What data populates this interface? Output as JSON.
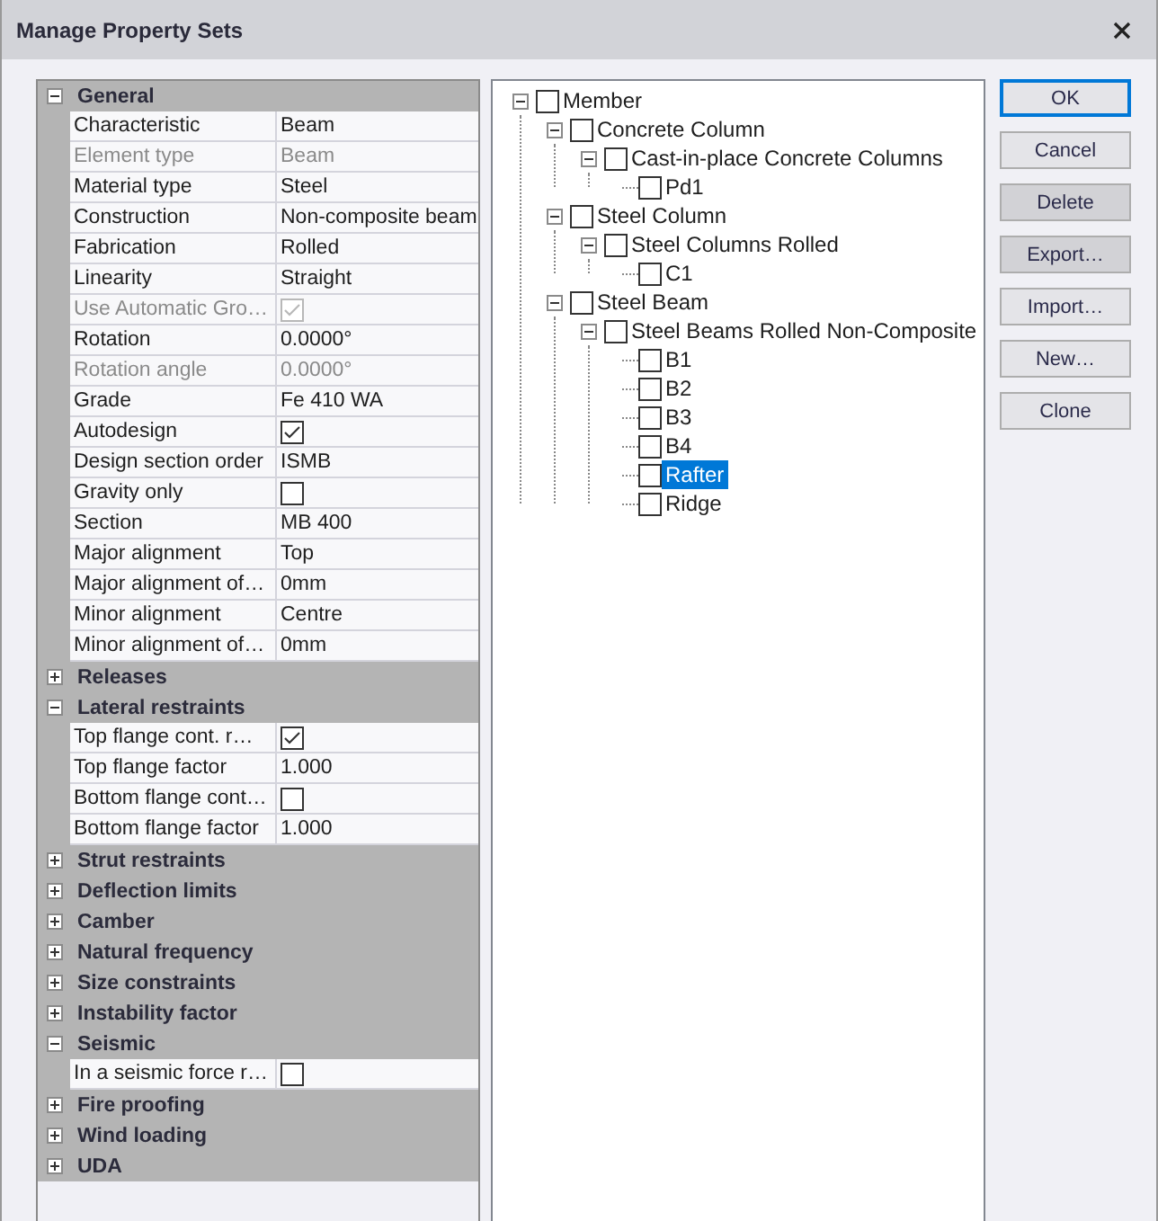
{
  "window": {
    "title": "Manage Property Sets"
  },
  "property_groups": [
    {
      "label": "General",
      "expanded": true,
      "properties": [
        {
          "name": "Characteristic",
          "kind": "text",
          "value": "Beam",
          "disabled": false
        },
        {
          "name": "Element type",
          "kind": "text",
          "value": "Beam",
          "disabled": true
        },
        {
          "name": "Material type",
          "kind": "text",
          "value": "Steel",
          "disabled": false
        },
        {
          "name": "Construction",
          "kind": "text",
          "value": "Non-composite beam",
          "disabled": false
        },
        {
          "name": "Fabrication",
          "kind": "text",
          "value": "Rolled",
          "disabled": false
        },
        {
          "name": "Linearity",
          "kind": "text",
          "value": "Straight",
          "disabled": false
        },
        {
          "name": "Use Automatic Gro…",
          "kind": "check",
          "checked": true,
          "disabled": true
        },
        {
          "name": "Rotation",
          "kind": "text",
          "value": "0.0000°",
          "disabled": false
        },
        {
          "name": "Rotation angle",
          "kind": "text",
          "value": "0.0000°",
          "disabled": true
        },
        {
          "name": "Grade",
          "kind": "text",
          "value": "Fe 410 WA",
          "disabled": false
        },
        {
          "name": "Autodesign",
          "kind": "check",
          "checked": true,
          "disabled": false
        },
        {
          "name": "Design section order",
          "kind": "text",
          "value": "ISMB",
          "disabled": false
        },
        {
          "name": "Gravity only",
          "kind": "check",
          "checked": false,
          "disabled": false
        },
        {
          "name": "Section",
          "kind": "text",
          "value": "MB 400",
          "disabled": false
        },
        {
          "name": "Major alignment",
          "kind": "text",
          "value": "Top",
          "disabled": false
        },
        {
          "name": "Major alignment of…",
          "kind": "text",
          "value": "0mm",
          "disabled": false
        },
        {
          "name": "Minor alignment",
          "kind": "text",
          "value": "Centre",
          "disabled": false
        },
        {
          "name": "Minor alignment of…",
          "kind": "text",
          "value": "0mm",
          "disabled": false
        }
      ]
    },
    {
      "label": "Releases",
      "expanded": false
    },
    {
      "label": "Lateral restraints",
      "expanded": true,
      "properties": [
        {
          "name": "Top flange cont. r…",
          "kind": "check",
          "checked": true,
          "disabled": false
        },
        {
          "name": "Top flange factor",
          "kind": "text",
          "value": "1.000",
          "disabled": false
        },
        {
          "name": "Bottom flange cont…",
          "kind": "check",
          "checked": false,
          "disabled": false
        },
        {
          "name": "Bottom flange factor",
          "kind": "text",
          "value": "1.000",
          "disabled": false
        }
      ]
    },
    {
      "label": "Strut restraints",
      "expanded": false
    },
    {
      "label": "Deflection limits",
      "expanded": false
    },
    {
      "label": "Camber",
      "expanded": false
    },
    {
      "label": "Natural frequency",
      "expanded": false
    },
    {
      "label": "Size constraints",
      "expanded": false
    },
    {
      "label": "Instability factor",
      "expanded": false
    },
    {
      "label": "Seismic",
      "expanded": true,
      "properties": [
        {
          "name": "In a seismic force r…",
          "kind": "check",
          "checked": false,
          "disabled": false
        }
      ]
    },
    {
      "label": "Fire proofing",
      "expanded": false
    },
    {
      "label": "Wind loading",
      "expanded": false
    },
    {
      "label": "UDA",
      "expanded": false
    }
  ],
  "tree": [
    {
      "label": "Member",
      "checked": false,
      "selected": false,
      "expanded": true,
      "children": [
        {
          "label": "Concrete Column",
          "checked": false,
          "selected": false,
          "expanded": true,
          "children": [
            {
              "label": "Cast-in-place Concrete Columns",
              "checked": false,
              "selected": false,
              "expanded": true,
              "children": [
                {
                  "label": "Pd1",
                  "checked": false,
                  "selected": false
                }
              ]
            }
          ]
        },
        {
          "label": "Steel Column",
          "checked": false,
          "selected": false,
          "expanded": true,
          "children": [
            {
              "label": "Steel Columns Rolled",
              "checked": false,
              "selected": false,
              "expanded": true,
              "children": [
                {
                  "label": "C1",
                  "checked": false,
                  "selected": false
                }
              ]
            }
          ]
        },
        {
          "label": "Steel Beam",
          "checked": false,
          "selected": false,
          "expanded": true,
          "children": [
            {
              "label": "Steel Beams Rolled Non-Composite",
              "checked": false,
              "selected": false,
              "expanded": true,
              "children": [
                {
                  "label": "B1",
                  "checked": false,
                  "selected": false
                },
                {
                  "label": "B2",
                  "checked": false,
                  "selected": false
                },
                {
                  "label": "B3",
                  "checked": false,
                  "selected": false
                },
                {
                  "label": "B4",
                  "checked": false,
                  "selected": false
                },
                {
                  "label": "Rafter",
                  "checked": false,
                  "selected": true
                },
                {
                  "label": "Ridge",
                  "checked": false,
                  "selected": false
                }
              ]
            }
          ]
        }
      ]
    }
  ],
  "buttons": [
    {
      "label": "OK",
      "default": true,
      "disabled": false
    },
    {
      "label": "Cancel",
      "default": false,
      "disabled": false
    },
    {
      "label": "Delete",
      "default": false,
      "disabled": true
    },
    {
      "label": "Export…",
      "default": false,
      "disabled": true
    },
    {
      "label": "Import…",
      "default": false,
      "disabled": false
    },
    {
      "label": "New…",
      "default": false,
      "disabled": false
    },
    {
      "label": "Clone",
      "default": false,
      "disabled": false
    }
  ]
}
